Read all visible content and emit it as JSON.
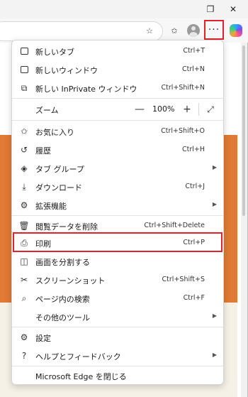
{
  "toolbar": {
    "more_label": "···"
  },
  "menu": {
    "items": [
      {
        "label": "新しいタブ",
        "shortcut": "Ctrl+T"
      },
      {
        "label": "新しいウィンドウ",
        "shortcut": "Ctrl+N"
      },
      {
        "label": "新しい InPrivate ウィンドウ",
        "shortcut": "Ctrl+Shift+N"
      },
      {
        "label": "ズーム",
        "zoom_value": "100%",
        "minus": "—",
        "plus": "+"
      },
      {
        "label": "お気に入り",
        "shortcut": "Ctrl+Shift+O"
      },
      {
        "label": "履歴",
        "shortcut": "Ctrl+H"
      },
      {
        "label": "タブ グループ",
        "shortcut": ""
      },
      {
        "label": "ダウンロード",
        "shortcut": "Ctrl+J"
      },
      {
        "label": "拡張機能",
        "shortcut": ""
      },
      {
        "label": "閲覧データを削除",
        "shortcut": "Ctrl+Shift+Delete"
      },
      {
        "label": "印刷",
        "shortcut": "Ctrl+P"
      },
      {
        "label": "画面を分割する",
        "shortcut": ""
      },
      {
        "label": "スクリーンショット",
        "shortcut": "Ctrl+Shift+S"
      },
      {
        "label": "ページ内の検索",
        "shortcut": "Ctrl+F"
      },
      {
        "label": "その他のツール",
        "shortcut": ""
      },
      {
        "label": "設定",
        "shortcut": ""
      },
      {
        "label": "ヘルプとフィードバック",
        "shortcut": ""
      },
      {
        "label": "Microsoft Edge を閉じる",
        "shortcut": ""
      }
    ]
  },
  "colors": {
    "highlight": "#e0232a",
    "page_orange": "#e07a34",
    "page_beige": "#f6f1e6"
  }
}
